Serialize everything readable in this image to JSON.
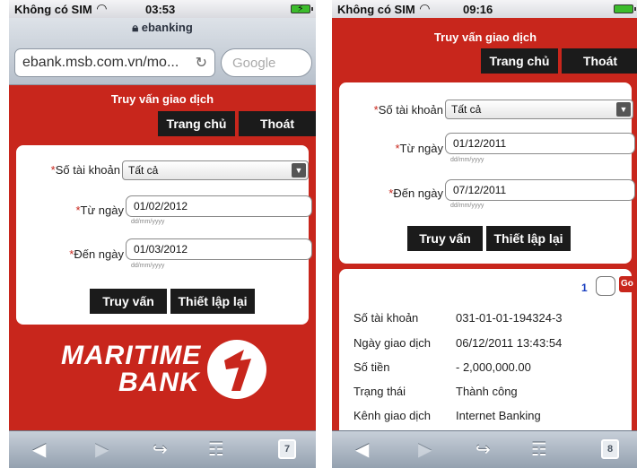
{
  "left": {
    "status": {
      "carrier": "Không có SIM",
      "time": "03:53"
    },
    "safari": {
      "title": "ebanking",
      "url": "ebank.msb.com.vn/mo...",
      "search_placeholder": "Google"
    },
    "page_title": "Truy vấn giao dịch",
    "nav": {
      "home": "Trang chủ",
      "logout": "Thoát"
    },
    "form": {
      "account_label": "Số tài khoản",
      "account_value": "Tất cả",
      "from_label": "Từ ngày",
      "from_value": "01/02/2012",
      "to_label": "Đến ngày",
      "to_value": "01/03/2012",
      "date_hint": "dd/mm/yyyy",
      "query_button": "Truy vấn",
      "reset_button": "Thiết lập lại"
    },
    "logo": {
      "line1": "MARITIME",
      "line2": "BANK"
    },
    "toolbar": {
      "tab_count": "7"
    }
  },
  "right": {
    "status": {
      "carrier": "Không có SIM",
      "time": "09:16"
    },
    "page_title": "Truy vấn giao dịch",
    "nav": {
      "home": "Trang chủ",
      "logout": "Thoát"
    },
    "form": {
      "account_label": "Số tài khoản",
      "account_value": "Tất cả",
      "from_label": "Từ ngày",
      "from_value": "01/12/2011",
      "to_label": "Đến ngày",
      "to_value": "07/12/2011",
      "date_hint": "dd/mm/yyyy",
      "query_button": "Truy vấn",
      "reset_button": "Thiết lập lại"
    },
    "pagination": {
      "page": "1",
      "go": "Go"
    },
    "result": [
      {
        "label": "Số tài khoản",
        "value": "031-01-01-194324-3"
      },
      {
        "label": "Ngày giao dịch",
        "value": "06/12/2011 13:43:54"
      },
      {
        "label": "Số tiền",
        "value": "- 2,000,000.00"
      },
      {
        "label": "Trạng thái",
        "value": "Thành công"
      },
      {
        "label": "Kênh giao dịch",
        "value": "Internet Banking"
      }
    ],
    "toolbar": {
      "tab_count": "8"
    }
  },
  "colors": {
    "brand_red": "#c8261c",
    "button_dark": "#1b1b1b",
    "battery_green": "#3cbc2c"
  }
}
